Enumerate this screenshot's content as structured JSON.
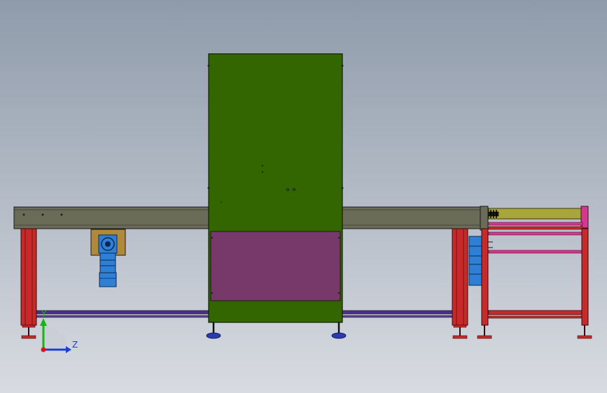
{
  "viewport": {
    "background_top": "#8f9bab",
    "background_bottom": "#d8dbe1"
  },
  "colors": {
    "cabinet_green": "#336600",
    "access_panel": "#77386a",
    "conveyor_beam": "#6b6c57",
    "leg_red": "#c62a2a",
    "rod_purple": "#4b2f8a",
    "motor_blue": "#2f7fd6",
    "gearbox_tan": "#b08a3a",
    "roller_yellow": "#a8a53a",
    "rod_pink": "#d23a8e",
    "foot_blue": "#2a3bb0",
    "axis_y": "#18b318",
    "axis_z": "#1e3ed8",
    "axis_origin": "#d81818"
  },
  "triad": {
    "y_label": "Y",
    "z_label": "Z"
  }
}
